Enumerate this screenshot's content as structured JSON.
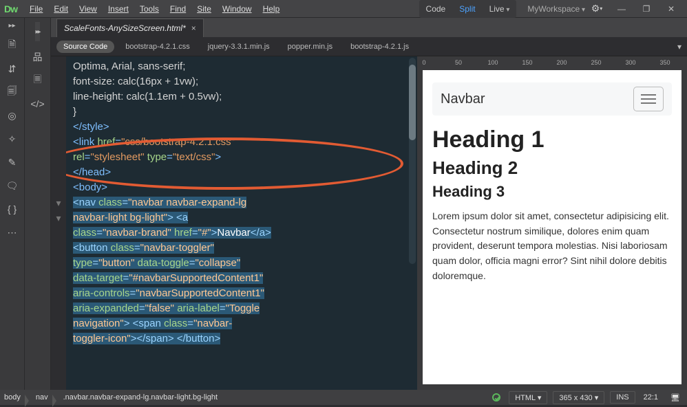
{
  "menubar": {
    "items": [
      "File",
      "Edit",
      "View",
      "Insert",
      "Tools",
      "Find",
      "Site",
      "Window",
      "Help"
    ]
  },
  "viewbuttons": {
    "code": "Code",
    "split": "Split",
    "live": "Live"
  },
  "workspace": {
    "name": "MyWorkspace"
  },
  "filetab": {
    "name": "ScaleFonts-AnySizeScreen.html*",
    "close": "×"
  },
  "related": {
    "source": "Source Code",
    "files": [
      "bootstrap-4.2.1.css",
      "jquery-3.3.1.min.js",
      "popper.min.js",
      "bootstrap-4.2.1.js"
    ]
  },
  "code_lines": {
    "l0": "Optima, Arial, sans-serif;",
    "l1": "font-size: calc(16px + 1vw);",
    "l2": "line-height: calc(1.1em + 0.5vw);",
    "l3": "}",
    "l4": "",
    "l5a": "</",
    "l5b": "style",
    "l5c": ">",
    "l6a": "<",
    "l6b": "link ",
    "l6c": "href",
    "l6d": "=",
    "l6e": "\"css/bootstrap-4.2.1.css\"",
    "l7a": "rel",
    "l7b": "=",
    "l7c": "\"stylesheet\" ",
    "l7d": "type",
    "l7e": "=",
    "l7f": "\"text/css\"",
    "l7g": ">",
    "l8a": "</",
    "l8b": "head",
    "l8c": ">",
    "l9a": "<",
    "l9b": "body",
    "l9c": ">",
    "l10a": "<",
    "l10b": "nav ",
    "l10c": "class",
    "l10d": "=",
    "l10e": "\"navbar navbar-expand-lg",
    "l11": "navbar-light bg-light\"",
    "l11b": "> <",
    "l11c": "a",
    "l12a": "class",
    "l12b": "=",
    "l12c": "\"navbar-brand\" ",
    "l12d": "href",
    "l12e": "=",
    "l12f": "\"#\"",
    "l12g": ">",
    "l12h": "Navbar",
    "l12i": "</",
    "l12j": "a",
    "l12k": ">",
    "l13a": "<",
    "l13b": "button ",
    "l13c": "class",
    "l13d": "=",
    "l13e": "\"navbar-toggler\"",
    "l14a": "type",
    "l14b": "=",
    "l14c": "\"button\" ",
    "l14d": "data-toggle",
    "l14e": "=",
    "l14f": "\"collapse\"",
    "l15a": "data-target",
    "l15b": "=",
    "l15c": "\"#navbarSupportedContent1\"",
    "l16a": "aria-controls",
    "l16b": "=",
    "l16c": "\"navbarSupportedContent1\"",
    "l17a": "aria-expanded",
    "l17b": "=",
    "l17c": "\"false\" ",
    "l17d": "aria-label",
    "l17e": "=",
    "l17f": "\"Toggle",
    "l18a": "navigation\"",
    "l18b": "> <",
    "l18c": "span ",
    "l18d": "class",
    "l18e": "=",
    "l18f": "\"navbar-",
    "l19a": "toggler-icon\"",
    "l19b": "></",
    "l19c": "span",
    "l19d": "> </",
    "l19e": "button",
    "l19f": ">"
  },
  "gutter": {
    "fold1": "▾",
    "fold2": "▾"
  },
  "ruler": {
    "t0": "0",
    "t50": "50",
    "t100": "100",
    "t150": "150",
    "t200": "200",
    "t250": "250",
    "t300": "300",
    "t350": "350"
  },
  "preview": {
    "brand": "Navbar",
    "h1": "Heading 1",
    "h2": "Heading 2",
    "h3": "Heading 3",
    "para": "Lorem ipsum dolor sit amet, consectetur adipisicing elit. Consectetur nostrum similique, dolores enim quam provident, deserunt tempora molestias. Nisi laboriosam quam dolor, officia magni error? Sint nihil dolore debitis doloremque."
  },
  "status": {
    "crumbs": [
      "body",
      "nav",
      ".navbar.navbar-expand-lg.navbar-light.bg-light"
    ],
    "doctype": "HTML",
    "size": "365 x 430",
    "ins": "INS",
    "pos": "22:1"
  }
}
